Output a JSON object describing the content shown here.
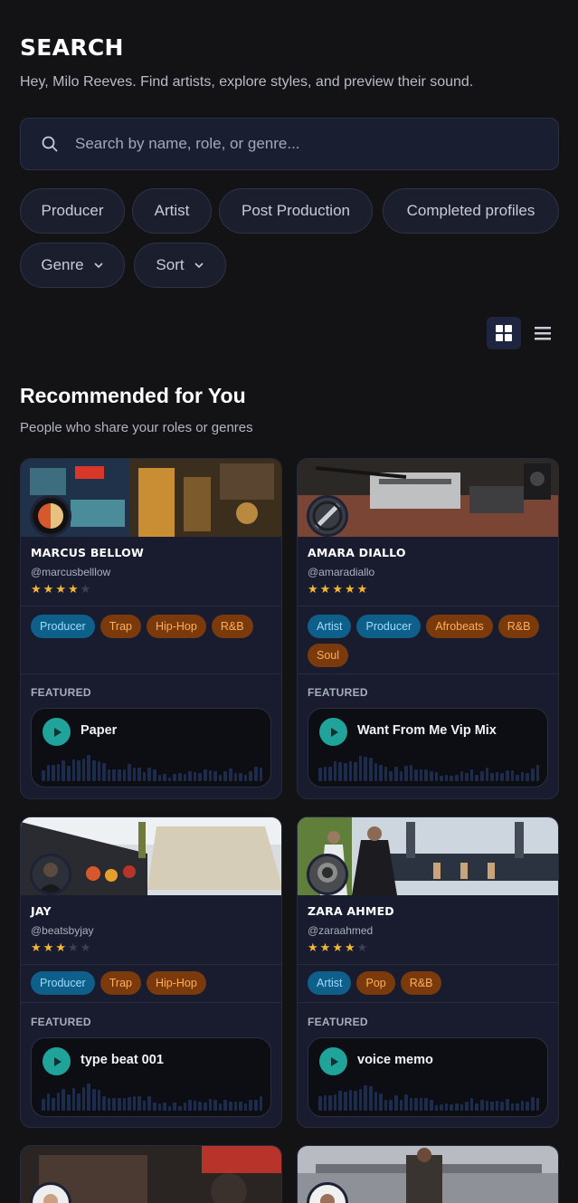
{
  "header": {
    "title": "SEARCH",
    "subtitle": "Hey, Milo Reeves. Find artists, explore styles, and preview their sound."
  },
  "search": {
    "placeholder": "Search by name, role, or genre..."
  },
  "filters": {
    "chips": [
      "Producer",
      "Artist",
      "Post Production",
      "Completed profiles"
    ],
    "dropdowns": [
      "Genre",
      "Sort"
    ]
  },
  "view_toggle": {
    "active": "grid",
    "icons": [
      "grid-icon",
      "list-icon"
    ]
  },
  "section": {
    "title": "Recommended for You",
    "subtitle": "People who share your roles or genres"
  },
  "colors": {
    "accent": "#20a39a",
    "role_tag": "#0e5f8a",
    "genre_tag": "#7a3a0b",
    "star": "#f5b731"
  },
  "cards": [
    {
      "name": "MARCUS BELLOW",
      "handle": "@marcusbelllow",
      "rating": 4,
      "roles": [
        "Producer"
      ],
      "genres": [
        "Trap",
        "Hip-Hop",
        "R&B"
      ],
      "featured_label": "FEATURED",
      "track": "Paper"
    },
    {
      "name": "AMARA DIALLO",
      "handle": "@amaradiallo",
      "rating": 5,
      "roles": [
        "Artist",
        "Producer"
      ],
      "genres": [
        "Afrobeats",
        "R&B",
        "Soul"
      ],
      "featured_label": "FEATURED",
      "track": "Want From Me Vip Mix"
    },
    {
      "name": "JAY",
      "handle": "@beatsbyjay",
      "rating": 3,
      "roles": [
        "Producer"
      ],
      "genres": [
        "Trap",
        "Hip-Hop"
      ],
      "featured_label": "FEATURED",
      "track": "type beat 001"
    },
    {
      "name": "ZARA AHMED",
      "handle": "@zaraahmed",
      "rating": 4,
      "roles": [
        "Artist"
      ],
      "genres": [
        "Pop",
        "R&B"
      ],
      "featured_label": "FEATURED",
      "track": "voice memo"
    }
  ]
}
